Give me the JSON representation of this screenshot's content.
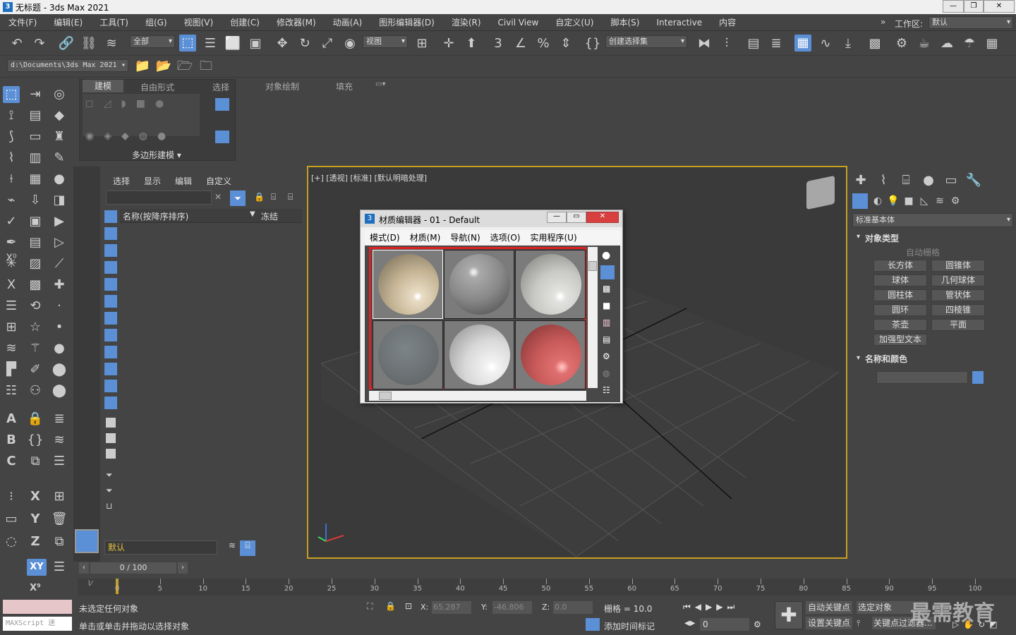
{
  "window": {
    "title": "无标题 - 3ds Max 2021"
  },
  "menu": [
    "文件(F)",
    "编辑(E)",
    "工具(T)",
    "组(G)",
    "视图(V)",
    "创建(C)",
    "修改器(M)",
    "动画(A)",
    "图形编辑器(D)",
    "渲染(R)",
    "Civil View",
    "自定义(U)",
    "脚本(S)",
    "Interactive",
    "内容"
  ],
  "workspace": {
    "label": "工作区:",
    "value": "默认"
  },
  "toolbar": {
    "filter": "全部",
    "refcoord": "视图",
    "selset": "创建选择集"
  },
  "path": {
    "value": "d:\\Documents\\3ds Max 2021"
  },
  "ribbon": {
    "tabs": [
      "建模",
      "自由形式",
      "选择",
      "对象绘制",
      "填充"
    ],
    "group": "多边形建模 ▾"
  },
  "scene_explorer": {
    "tabs": [
      "选择",
      "显示",
      "编辑",
      "自定义"
    ],
    "col_name": "名称(按降序排序)",
    "col_freeze": "冻结",
    "layer": "默认"
  },
  "viewport": {
    "label": "[+] [透视] [标准] [默认明暗处理]"
  },
  "mat_editor": {
    "badge": "3",
    "title": "材质编辑器 - 01 - Default",
    "menu": [
      "模式(D)",
      "材质(M)",
      "导航(N)",
      "选项(O)",
      "实用程序(U)"
    ]
  },
  "command_panel": {
    "dropdown": "标准基本体",
    "rollout1": "对象类型",
    "autogrid": "自动栅格",
    "buttons": [
      "长方体",
      "圆锥体",
      "球体",
      "几何球体",
      "圆柱体",
      "管状体",
      "圆环",
      "四棱锥",
      "茶壶",
      "平面",
      "加强型文本"
    ],
    "rollout2": "名称和颜色"
  },
  "timeline": {
    "frame": "0 / 100",
    "ticks": [
      "0",
      "5",
      "10",
      "15",
      "20",
      "25",
      "30",
      "35",
      "40",
      "45",
      "50",
      "55",
      "60",
      "65",
      "70",
      "75",
      "80",
      "85",
      "90",
      "95",
      "100"
    ]
  },
  "status": {
    "line1": "未选定任何对象",
    "line2": "单击或单击并拖动以选择对象",
    "maxscript": "MAXScript 迷",
    "x_label": "X:",
    "x_val": "65.287",
    "y_label": "Y:",
    "y_val": "-46.806",
    "z_label": "Z:",
    "z_val": "0.0",
    "grid": "栅格 = 10.0",
    "add_time": "添加时间标记",
    "autokey": "自动关键点",
    "selected": "选定对象",
    "setkey": "设置关键点",
    "keyfilter": "关键点过滤器...",
    "frame": "0"
  },
  "watermark": "最需教育",
  "colors": {
    "accent": "#5b8fd6",
    "highlight": "#e02020",
    "viewport_border": "#c8a020"
  }
}
